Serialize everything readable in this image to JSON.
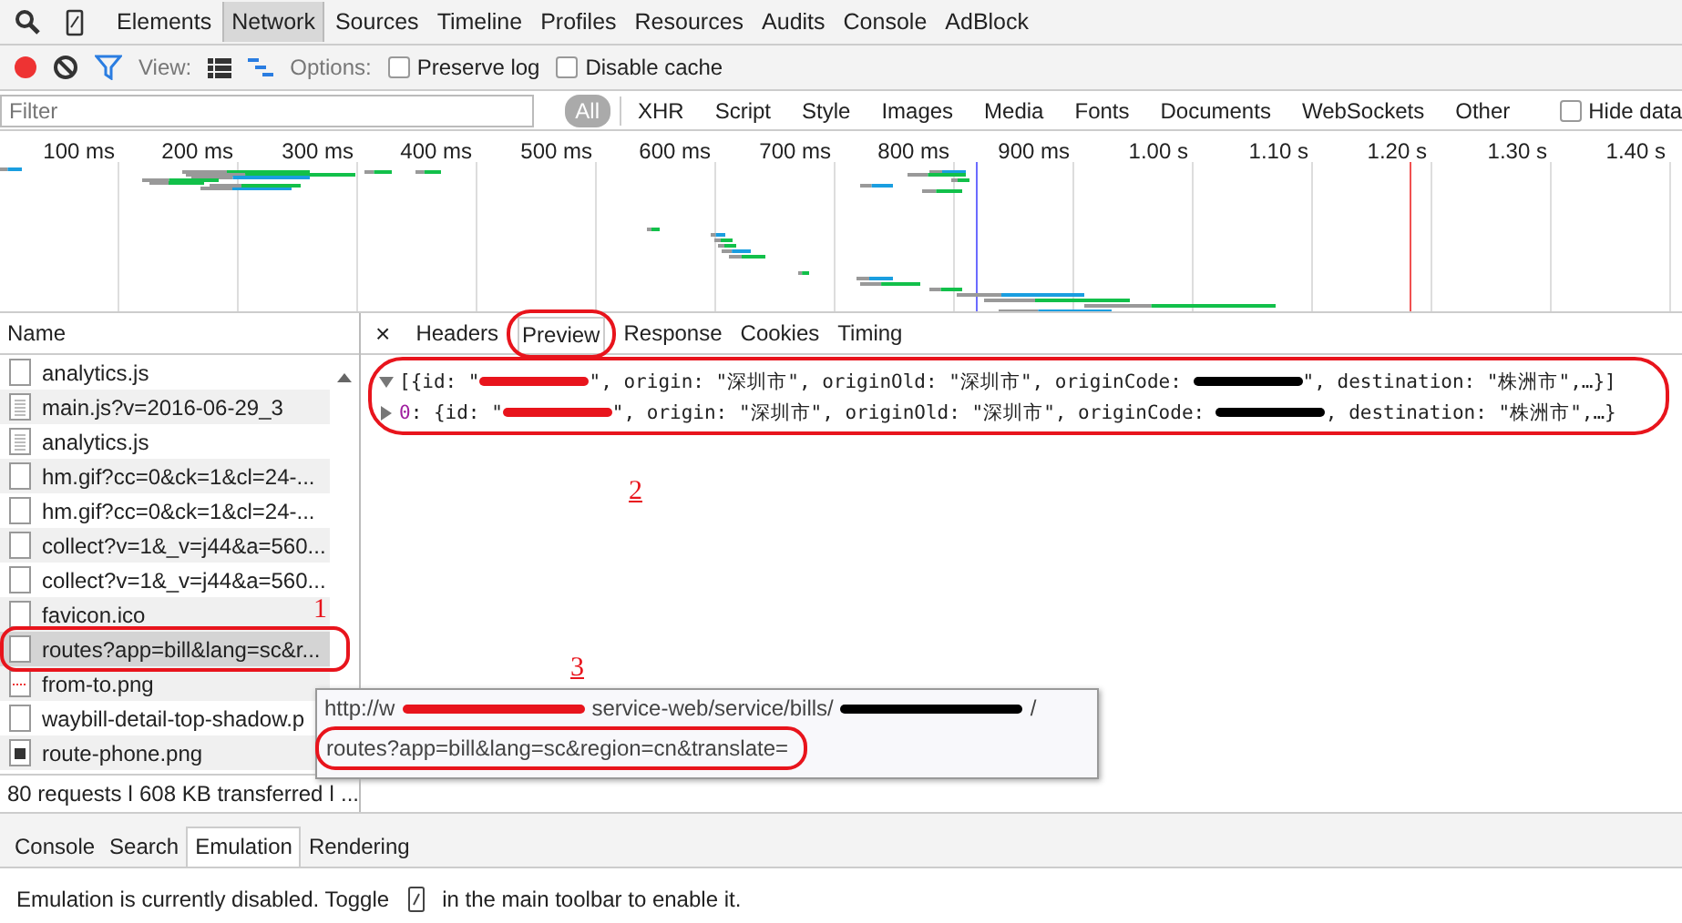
{
  "main_tabs": [
    {
      "label": "Elements",
      "selected": false
    },
    {
      "label": "Network",
      "selected": true
    },
    {
      "label": "Sources",
      "selected": false
    },
    {
      "label": "Timeline",
      "selected": false
    },
    {
      "label": "Profiles",
      "selected": false
    },
    {
      "label": "Resources",
      "selected": false
    },
    {
      "label": "Audits",
      "selected": false
    },
    {
      "label": "Console",
      "selected": false
    },
    {
      "label": "AdBlock",
      "selected": false
    }
  ],
  "toolbar": {
    "recording": true,
    "view_label": "View:",
    "options_label": "Options:",
    "checkboxes": [
      {
        "label": "Preserve log",
        "checked": false
      },
      {
        "label": "Disable cache",
        "checked": false
      }
    ]
  },
  "filter": {
    "placeholder": "Filter",
    "types": [
      {
        "label": "All",
        "selected": true
      },
      {
        "label": "XHR",
        "selected": false
      },
      {
        "label": "Script",
        "selected": false
      },
      {
        "label": "Style",
        "selected": false
      },
      {
        "label": "Images",
        "selected": false
      },
      {
        "label": "Media",
        "selected": false
      },
      {
        "label": "Fonts",
        "selected": false
      },
      {
        "label": "Documents",
        "selected": false
      },
      {
        "label": "WebSockets",
        "selected": false
      },
      {
        "label": "Other",
        "selected": false
      }
    ],
    "hide_data": {
      "label": "Hide data",
      "checked": false
    }
  },
  "timeline": {
    "ticks": [
      "100 ms",
      "200 ms",
      "300 ms",
      "400 ms",
      "500 ms",
      "600 ms",
      "700 ms",
      "800 ms",
      "900 ms",
      "1.00 s",
      "1.10 s",
      "1.20 s",
      "1.30 s",
      "1.40 s"
    ]
  },
  "requests": {
    "header": "Name",
    "rows": [
      {
        "name": "analytics.js",
        "kind": "blank",
        "selected": false
      },
      {
        "name": "main.js?v=2016-06-29_3",
        "kind": "script",
        "selected": false
      },
      {
        "name": "analytics.js",
        "kind": "script",
        "selected": false
      },
      {
        "name": "hm.gif?cc=0&ck=1&cl=24-...",
        "kind": "blank",
        "selected": false
      },
      {
        "name": "hm.gif?cc=0&ck=1&cl=24-...",
        "kind": "blank",
        "selected": false
      },
      {
        "name": "collect?v=1&_v=j44&a=560...",
        "kind": "blank",
        "selected": false
      },
      {
        "name": "collect?v=1&_v=j44&a=560...",
        "kind": "blank",
        "selected": false
      },
      {
        "name": "favicon.ico",
        "kind": "blank",
        "selected": false
      },
      {
        "name": "routes?app=bill&lang=sc&r...",
        "kind": "blank",
        "selected": true
      },
      {
        "name": "from-to.png",
        "kind": "image",
        "selected": false
      },
      {
        "name": "waybill-detail-top-shadow.p",
        "kind": "blank",
        "selected": false
      },
      {
        "name": "route-phone.png",
        "kind": "phone",
        "selected": false
      }
    ],
    "summary": "80 requests ǀ 608 KB transferred ǀ ..."
  },
  "detail": {
    "close": "×",
    "tabs": [
      {
        "label": "Headers",
        "selected": false
      },
      {
        "label": "Preview",
        "selected": true
      },
      {
        "label": "Response",
        "selected": false
      },
      {
        "label": "Cookies",
        "selected": false
      },
      {
        "label": "Timing",
        "selected": false
      }
    ],
    "lines": [
      {
        "expanded": true,
        "segments": [
          {
            "kind": "text",
            "text": "[{id: \""
          },
          {
            "kind": "redacted",
            "color": "#e8141c"
          },
          {
            "kind": "text",
            "text": "\", origin: \"深圳市\", originOld: \"深圳市\", originCode: "
          },
          {
            "kind": "redacted",
            "color": "#000000"
          },
          {
            "kind": "text",
            "text": "\", destination: \"株洲市\",…}]"
          }
        ]
      },
      {
        "expanded": false,
        "index": "0",
        "segments": [
          {
            "kind": "text",
            "text": ": {id: \""
          },
          {
            "kind": "redacted",
            "color": "#e8141c"
          },
          {
            "kind": "text",
            "text": "\", origin: \"深圳市\", originOld: \"深圳市\", originCode: "
          },
          {
            "kind": "redacted",
            "color": "#000000"
          },
          {
            "kind": "text",
            "text": ", destination: \"株洲市\",…}"
          }
        ]
      }
    ]
  },
  "tooltip": {
    "lines": [
      [
        {
          "kind": "text",
          "text": "http://w"
        },
        {
          "kind": "redacted",
          "color": "#e8141c"
        },
        {
          "kind": "text",
          "text": "service-web/service/bills/"
        },
        {
          "kind": "redacted",
          "color": "#000000"
        },
        {
          "kind": "text",
          "text": "/"
        }
      ],
      [
        {
          "kind": "text",
          "text": "routes?app=bill&lang=sc&region=cn&translate="
        }
      ]
    ]
  },
  "drawer": {
    "tabs": [
      {
        "label": "Console",
        "selected": false
      },
      {
        "label": "Search",
        "selected": false
      },
      {
        "label": "Emulation",
        "selected": true
      },
      {
        "label": "Rendering",
        "selected": false
      }
    ],
    "message_before": "Emulation is currently disabled. Toggle",
    "message_after": "in the main toolbar to enable it."
  },
  "annotations": [
    {
      "label": "1",
      "underlined": false
    },
    {
      "label": "2",
      "underlined": true
    },
    {
      "label": "3",
      "underlined": true
    }
  ]
}
